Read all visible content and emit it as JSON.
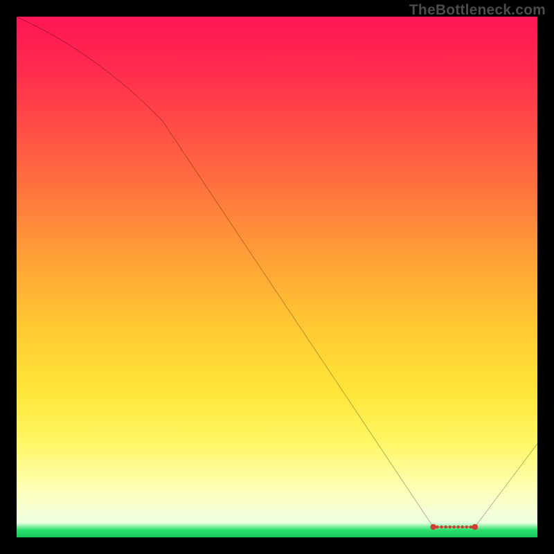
{
  "credit": "TheBottleneck.com",
  "chart_data": {
    "type": "line",
    "title": "",
    "xlabel": "",
    "ylabel": "",
    "xlim": [
      0,
      100
    ],
    "ylim": [
      0,
      100
    ],
    "x": [
      0,
      28,
      80,
      88,
      100
    ],
    "values": [
      100,
      80,
      2,
      2,
      18
    ],
    "optimum_band": {
      "x_start": 80,
      "x_end": 88,
      "y": 2
    },
    "annotations": []
  },
  "colors": {
    "curve": "#000000",
    "marker_fill": "#d83a2f",
    "marker_stroke": "#7a1510"
  }
}
